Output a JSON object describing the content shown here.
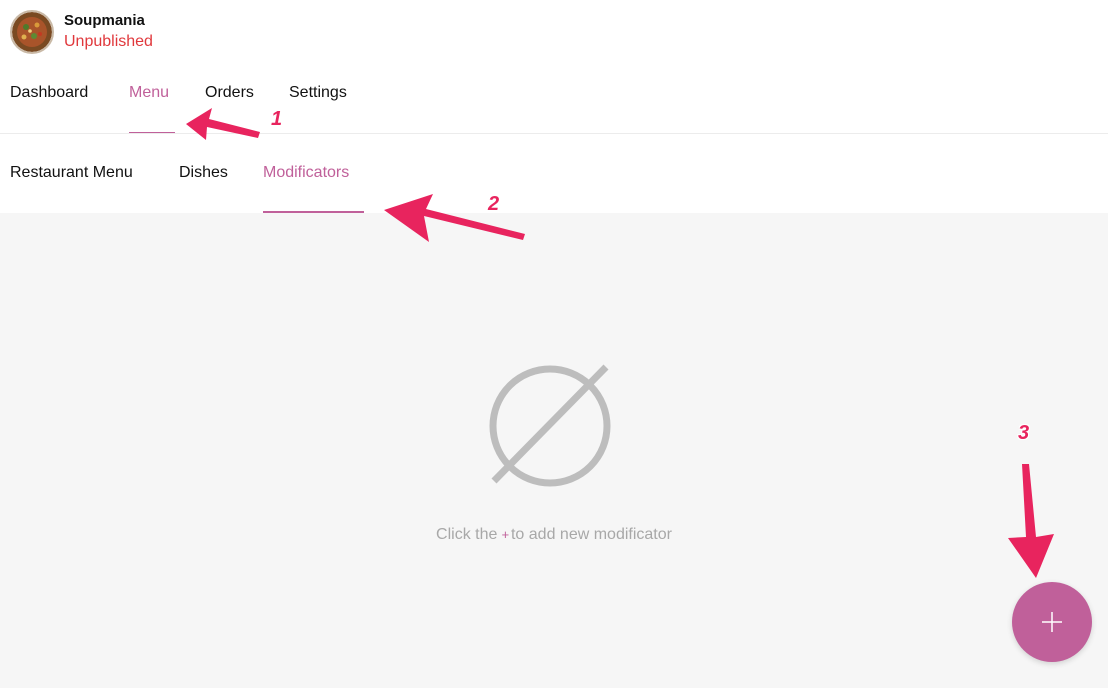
{
  "restaurant": {
    "name": "Soupmania",
    "status": "Unpublished",
    "avatar_icon": "soup-bowl-photo"
  },
  "main_nav": {
    "items": [
      {
        "label": "Dashboard",
        "active": false
      },
      {
        "label": "Menu",
        "active": true
      },
      {
        "label": "Orders",
        "active": false
      },
      {
        "label": "Settings",
        "active": false
      }
    ]
  },
  "sub_nav": {
    "items": [
      {
        "label": "Restaurant Menu",
        "active": false
      },
      {
        "label": "Dishes",
        "active": false
      },
      {
        "label": "Modificators",
        "active": true
      }
    ]
  },
  "empty_state": {
    "icon": "empty-set-icon",
    "text_before": "Click the",
    "plus_symbol": "+",
    "text_after": "to add new modificator"
  },
  "fab": {
    "icon": "plus-icon"
  },
  "annotations": [
    {
      "number": "1",
      "points_to": "menu-tab"
    },
    {
      "number": "2",
      "points_to": "modificators-tab"
    },
    {
      "number": "3",
      "points_to": "add-button"
    }
  ],
  "colors": {
    "accent": "#c0609a",
    "status_red": "#e0383c",
    "annotation": "#e8245e",
    "content_bg": "#f6f6f6",
    "empty_icon": "#bdbdbd"
  }
}
